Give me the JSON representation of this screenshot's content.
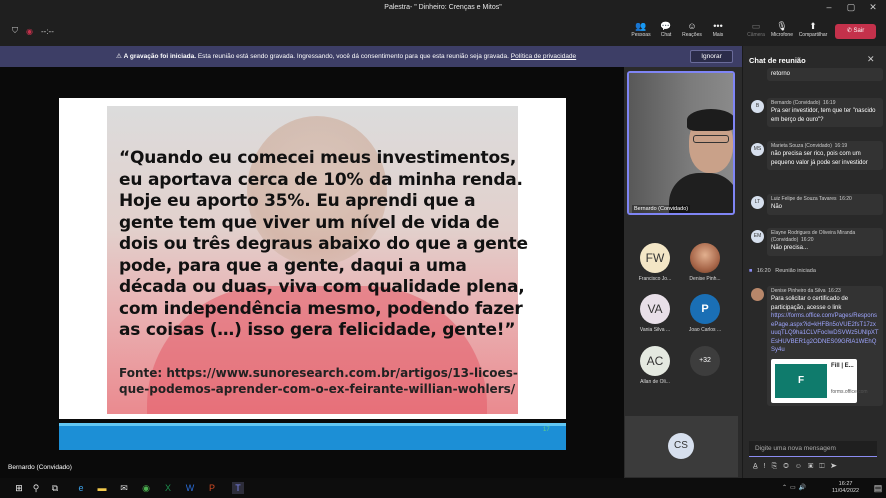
{
  "window": {
    "title": "Palestra- \" Dinheiro: Crenças e Mitos\""
  },
  "toolbar": {
    "timer": "--:--",
    "people": "Pessoas",
    "chat": "Chat",
    "reactions": "Reações",
    "more": "Mais",
    "camera": "Câmera",
    "mic": "Microfone",
    "share": "Compartilhar",
    "leave": "Sair"
  },
  "banner": {
    "strong": "A gravação foi iniciada.",
    "text": "Esta reunião está sendo gravada. Ingressando, você dá consentimento para que esta reunião seja gravada.",
    "link": "Política de privacidade",
    "ignore": "Ignorar"
  },
  "slide": {
    "quote": "“Quando eu comecei meus investimentos, eu aportava cerca de 10% da minha renda. Hoje eu aporto 35%. Eu aprendi que a gente tem que viver um nível de vida de dois ou três degraus abaixo do que a gente pode, para que a gente, daqui a uma década ou duas, viva com qualidade plena, com independência mesmo, podendo fazer as coisas (…) isso gera felicidade, gente!”",
    "source": "Fonte: https://www.sunoresearch.com.br/artigos/13-licoes-que-podemos-aprender-com-o-ex-feirante-willian-wohlers/",
    "page": "17"
  },
  "presenter_label": "Bernardo (Convidado)",
  "self_cam_label": "Bernardo (Convidado)",
  "participants": [
    {
      "initials": "FW",
      "name": "Francisco Jo...",
      "color": "#f3e6c6"
    },
    {
      "initials": "",
      "name": "Denise Pinh...",
      "color": "#c98a6d"
    },
    {
      "initials": "VA",
      "name": "Vania Silva ...",
      "color": "#e8dfe8"
    },
    {
      "initials": "",
      "name": "Joao Carlos ...",
      "color": "#1a6fb5"
    },
    {
      "initials": "AC",
      "name": "Allan de Oli...",
      "color": "#e4e9e0"
    }
  ],
  "more_count": "+32",
  "cs_tile": "CS",
  "chat": {
    "header": "Chat de reunião",
    "top_fragment": "retorno",
    "messages": [
      {
        "initials": "B",
        "author": "Bernardo (Convidado)",
        "time": "16:19",
        "text": "Pra ser investidor, tem que ter \"nascido em berço de ouro\"?"
      },
      {
        "initials": "MS",
        "author": "Marieta Souza (Convidado)",
        "time": "16:19",
        "text": "não precisa ser rico, pois com um pequeno valor já pode ser investidor"
      },
      {
        "initials": "LT",
        "author": "Luiz Felipe de Souza Tavares",
        "time": "16:20",
        "text": "Não"
      },
      {
        "initials": "EM",
        "author": "Elayne Rodrigues de Oliveira Miranda (Convidado)",
        "time": "16:20",
        "text": "Não precisa..."
      }
    ],
    "system": {
      "time": "16:20",
      "text": "Reunião iniciada"
    },
    "last": {
      "author": "Denise Pinheiro da Silva",
      "time": "16:23",
      "text": "Para solicitar o certificado de participação, acesse o link",
      "link": "https://forms.office.com/Pages/ResponsePage.aspx?id=kHFBn5oVUE2fsT17zxuuqTLQ9ha1CLVFocIwDSVWz5UNlpXTEsHUVBER1g2ODNES09GRlA1WEhQSy4u",
      "card_title": "Fill | E...",
      "card_sub": "forms.office.com"
    },
    "compose_placeholder": "Digite uma nova mensagem"
  },
  "taskbar": {
    "time": "16:27",
    "date": "11/04/2022"
  }
}
